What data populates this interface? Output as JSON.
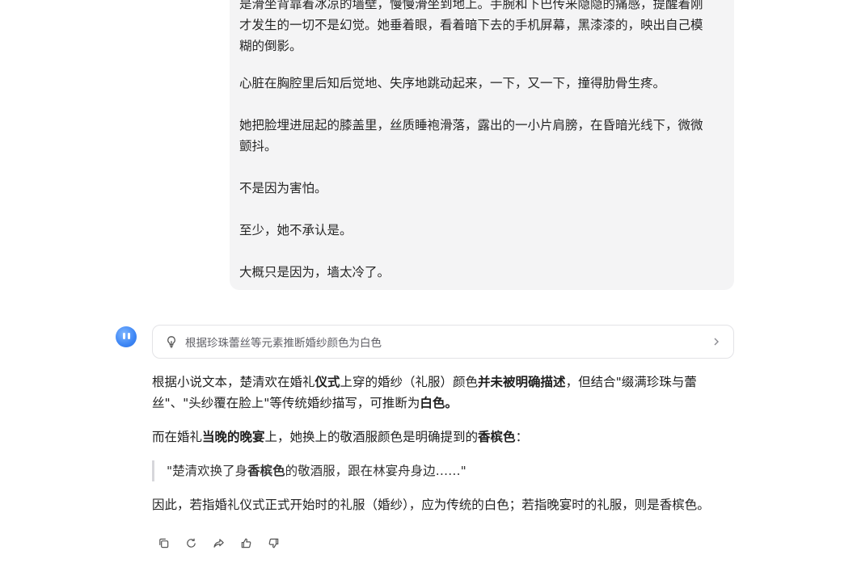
{
  "user_message": {
    "paragraphs": [
      "是滑坐背靠着冰凉的墙壁，慢慢滑坐到地上。手腕和下巴传来隐隐的痛感，提醒着刚",
      "才发生的一切不是幻觉。她垂着眼，看着暗下去的手机屏幕，黑漆漆的，映出自己模",
      "糊的倒影。",
      "心脏在胸腔里后知后觉地、失序地跳动起来，一下，又一下，撞得肋骨生疼。",
      "她把脸埋进屈起的膝盖里，丝质睡袍滑落，露出的一小片肩膀，在昏暗光线下，微微",
      "颤抖。",
      "不是因为害怕。",
      "至少，她不承认是。",
      "大概只是因为，墙太冷了。"
    ]
  },
  "assistant": {
    "reasoning_summary": "根据珍珠蕾丝等元素推断婚纱颜色为白色",
    "p1": {
      "a": "根据小说文本，楚清欢在婚礼",
      "b": "仪式",
      "c": "上穿的婚纱（礼服）颜色",
      "d": "并未被明确描述",
      "e": "，但结合\"缀满珍珠与蕾",
      "f": "丝\"、\"头纱覆在脸上\"等传统婚纱描写，可推断为",
      "g": "白色。"
    },
    "p2": {
      "a": "而在婚礼",
      "b": "当晚的晚宴",
      "c": "上，她换上的敬酒服颜色是明确提到的",
      "d": "香槟色",
      "e": "："
    },
    "quote": {
      "a": "\"楚清欢换了身",
      "b": "香槟色",
      "c": "的敬酒服，跟在林宴舟身边……\""
    },
    "p3": "因此，若指婚礼仪式正式开始时的礼服（婚纱），应为传统的白色；若指晚宴时的礼服，则是香槟色。"
  },
  "actions": [
    "copy-icon",
    "regenerate-icon",
    "share-icon",
    "thumbs-up-icon",
    "thumbs-down-icon"
  ],
  "colors": {
    "bubble_bg": "#f4f4f5",
    "avatar": "#3d86f5",
    "border": "#e3e3e6",
    "quote_bar": "#d7d7db"
  }
}
